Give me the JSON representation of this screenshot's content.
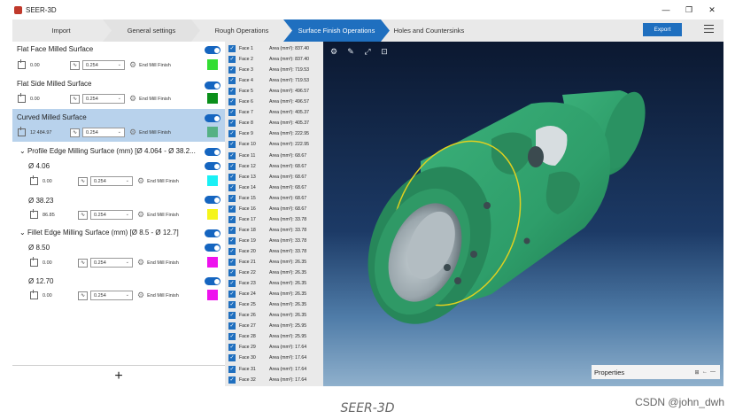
{
  "window": {
    "title": "SEER-3D",
    "minimize": "—",
    "restore": "❐",
    "close": "✕"
  },
  "steps": [
    {
      "label": "Import",
      "width": 110
    },
    {
      "label": "General settings",
      "width": 110
    },
    {
      "label": "Rough Operations",
      "width": 110
    },
    {
      "label": "Surface Finish Operations",
      "width": 120,
      "active": true
    },
    {
      "label": "Holes and Countersinks",
      "width": 105
    }
  ],
  "toolbar": {
    "export_label": "Export"
  },
  "surfaces": {
    "flat_face": {
      "title": "Flat Face Milled Surface",
      "value": "0.00",
      "tolerance": "0.254",
      "tool": "End Mill Finish",
      "color": "#33dd33"
    },
    "flat_side": {
      "title": "Flat Side Milled Surface",
      "value": "0.00",
      "tolerance": "0.254",
      "tool": "End Mill Finish",
      "color": "#0a8f1a"
    },
    "curved": {
      "title": "Curved Milled Surface",
      "value": "12 484.97",
      "tolerance": "0.254",
      "tool": "End Mill Finish",
      "color": "#55b184"
    },
    "profile_group": {
      "title": "Profile Edge Milling Surface (mm) [Ø 4.064 - Ø 38.2..."
    },
    "profile_4": {
      "title": "Ø 4.06",
      "value": "0.00",
      "tolerance": "0.254",
      "tool": "End Mill Finish",
      "color": "#1af0f5"
    },
    "profile_38": {
      "title": "Ø 38.23",
      "value": "86.85",
      "tolerance": "0.254",
      "tool": "End Mill Finish",
      "color": "#f5f51a"
    },
    "fillet_group": {
      "title": "Fillet Edge Milling Surface (mm) [Ø 8.5 - Ø 12.7]"
    },
    "fillet_8": {
      "title": "Ø 8.50",
      "value": "0.00",
      "tolerance": "0.254",
      "tool": "End Mill Finish",
      "color": "#ee11ee"
    },
    "fillet_12": {
      "title": "Ø 12.70",
      "value": "0.00",
      "tolerance": "0.254",
      "tool": "End Mill Finish",
      "color": "#ee11ee"
    }
  },
  "add_label": "+",
  "faces": [
    {
      "name": "Face 1",
      "area": "Area (mm²): 837.40"
    },
    {
      "name": "Face 2",
      "area": "Area (mm²): 837.40"
    },
    {
      "name": "Face 3",
      "area": "Area (mm²): 719.53"
    },
    {
      "name": "Face 4",
      "area": "Area (mm²): 719.53"
    },
    {
      "name": "Face 5",
      "area": "Area (mm²): 496.57"
    },
    {
      "name": "Face 6",
      "area": "Area (mm²): 496.57"
    },
    {
      "name": "Face 7",
      "area": "Area (mm²): 405.37"
    },
    {
      "name": "Face 8",
      "area": "Area (mm²): 405.37"
    },
    {
      "name": "Face 9",
      "area": "Area (mm²): 222.95"
    },
    {
      "name": "Face 10",
      "area": "Area (mm²): 222.95"
    },
    {
      "name": "Face 11",
      "area": "Area (mm²): 68.67"
    },
    {
      "name": "Face 12",
      "area": "Area (mm²): 68.67"
    },
    {
      "name": "Face 13",
      "area": "Area (mm²): 68.67"
    },
    {
      "name": "Face 14",
      "area": "Area (mm²): 68.67"
    },
    {
      "name": "Face 15",
      "area": "Area (mm²): 68.67"
    },
    {
      "name": "Face 16",
      "area": "Area (mm²): 68.67"
    },
    {
      "name": "Face 17",
      "area": "Area (mm²): 33.78"
    },
    {
      "name": "Face 18",
      "area": "Area (mm²): 33.78"
    },
    {
      "name": "Face 19",
      "area": "Area (mm²): 33.78"
    },
    {
      "name": "Face 20",
      "area": "Area (mm²): 33.78"
    },
    {
      "name": "Face 21",
      "area": "Area (mm²): 26.35"
    },
    {
      "name": "Face 22",
      "area": "Area (mm²): 26.35"
    },
    {
      "name": "Face 23",
      "area": "Area (mm²): 26.35"
    },
    {
      "name": "Face 24",
      "area": "Area (mm²): 26.35"
    },
    {
      "name": "Face 25",
      "area": "Area (mm²): 26.35"
    },
    {
      "name": "Face 26",
      "area": "Area (mm²): 26.35"
    },
    {
      "name": "Face 27",
      "area": "Area (mm²): 25.95"
    },
    {
      "name": "Face 28",
      "area": "Area (mm²): 25.95"
    },
    {
      "name": "Face 29",
      "area": "Area (mm²): 17.64"
    },
    {
      "name": "Face 30",
      "area": "Area (mm²): 17.64"
    },
    {
      "name": "Face 31",
      "area": "Area (mm²): 17.64"
    },
    {
      "name": "Face 32",
      "area": "Area (mm²): 17.64"
    }
  ],
  "properties": {
    "label": "Properties"
  },
  "caption": "SEER-3D",
  "watermark": "CSDN @john_dwh",
  "colors": {
    "accent": "#1f6fbf",
    "part": "#2e9e6a",
    "highlight_edge": "#e0d020"
  }
}
